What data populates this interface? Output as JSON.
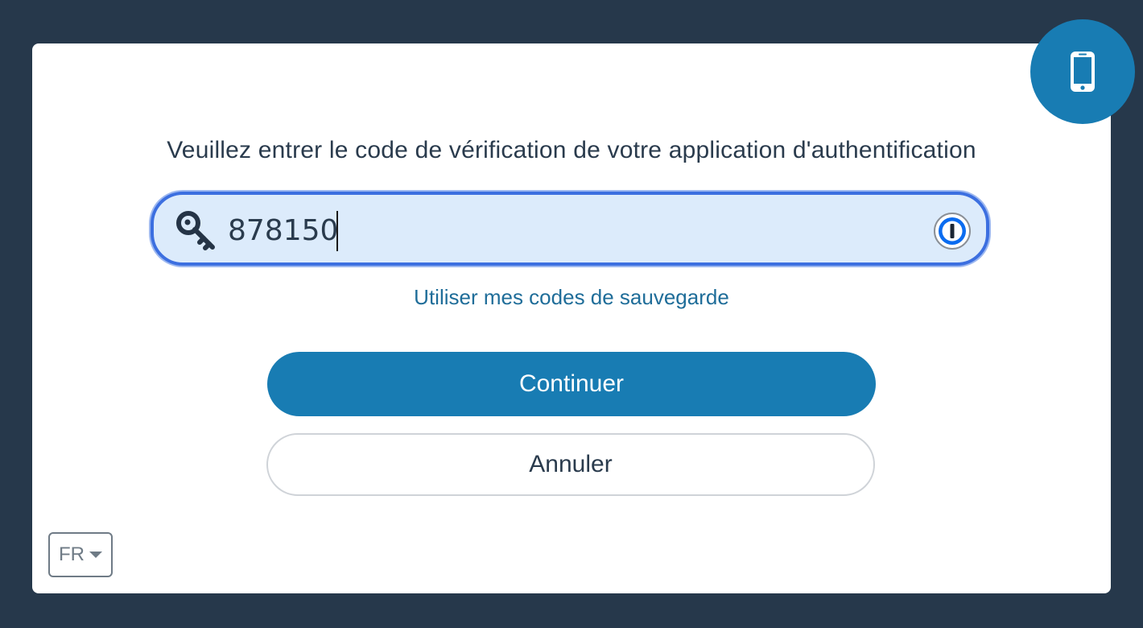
{
  "header": {
    "icon": "mobile-phone-icon"
  },
  "prompt": {
    "text": "Veuillez entrer le code de vérification de votre application d'authentification"
  },
  "code_field": {
    "value": "878150",
    "icon": "key-icon",
    "password_manager_icon": "1password-icon",
    "accent_color": "#3c6fe0"
  },
  "backup_link": {
    "label": "Utiliser mes codes de sauvegarde"
  },
  "buttons": {
    "continue_label": "Continuer",
    "cancel_label": "Annuler"
  },
  "language": {
    "selected": "FR"
  },
  "colors": {
    "background": "#26384b",
    "brand": "#187cb3",
    "link": "#1f6d99"
  }
}
